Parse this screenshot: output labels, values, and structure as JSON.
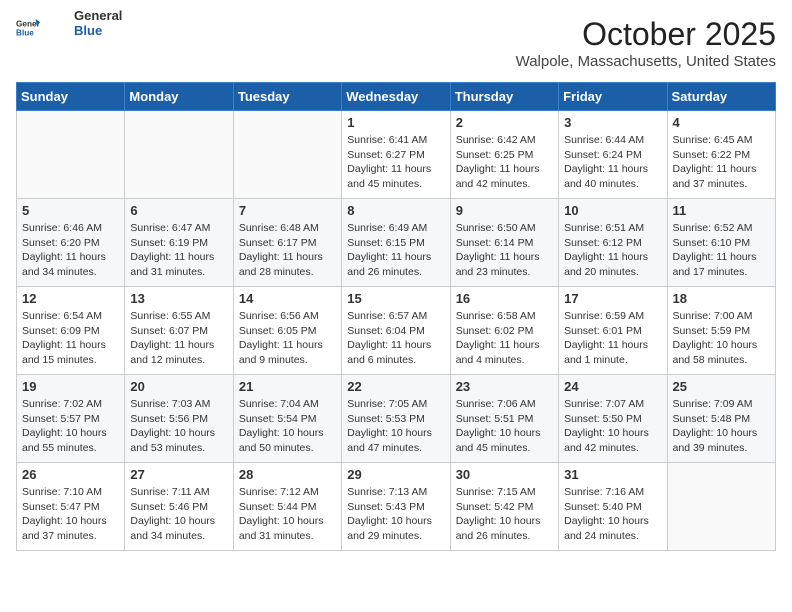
{
  "header": {
    "logo_general": "General",
    "logo_blue": "Blue",
    "month": "October 2025",
    "location": "Walpole, Massachusetts, United States"
  },
  "days_of_week": [
    "Sunday",
    "Monday",
    "Tuesday",
    "Wednesday",
    "Thursday",
    "Friday",
    "Saturday"
  ],
  "weeks": [
    [
      {
        "day": "",
        "info": ""
      },
      {
        "day": "",
        "info": ""
      },
      {
        "day": "",
        "info": ""
      },
      {
        "day": "1",
        "info": "Sunrise: 6:41 AM\nSunset: 6:27 PM\nDaylight: 11 hours and 45 minutes."
      },
      {
        "day": "2",
        "info": "Sunrise: 6:42 AM\nSunset: 6:25 PM\nDaylight: 11 hours and 42 minutes."
      },
      {
        "day": "3",
        "info": "Sunrise: 6:44 AM\nSunset: 6:24 PM\nDaylight: 11 hours and 40 minutes."
      },
      {
        "day": "4",
        "info": "Sunrise: 6:45 AM\nSunset: 6:22 PM\nDaylight: 11 hours and 37 minutes."
      }
    ],
    [
      {
        "day": "5",
        "info": "Sunrise: 6:46 AM\nSunset: 6:20 PM\nDaylight: 11 hours and 34 minutes."
      },
      {
        "day": "6",
        "info": "Sunrise: 6:47 AM\nSunset: 6:19 PM\nDaylight: 11 hours and 31 minutes."
      },
      {
        "day": "7",
        "info": "Sunrise: 6:48 AM\nSunset: 6:17 PM\nDaylight: 11 hours and 28 minutes."
      },
      {
        "day": "8",
        "info": "Sunrise: 6:49 AM\nSunset: 6:15 PM\nDaylight: 11 hours and 26 minutes."
      },
      {
        "day": "9",
        "info": "Sunrise: 6:50 AM\nSunset: 6:14 PM\nDaylight: 11 hours and 23 minutes."
      },
      {
        "day": "10",
        "info": "Sunrise: 6:51 AM\nSunset: 6:12 PM\nDaylight: 11 hours and 20 minutes."
      },
      {
        "day": "11",
        "info": "Sunrise: 6:52 AM\nSunset: 6:10 PM\nDaylight: 11 hours and 17 minutes."
      }
    ],
    [
      {
        "day": "12",
        "info": "Sunrise: 6:54 AM\nSunset: 6:09 PM\nDaylight: 11 hours and 15 minutes."
      },
      {
        "day": "13",
        "info": "Sunrise: 6:55 AM\nSunset: 6:07 PM\nDaylight: 11 hours and 12 minutes."
      },
      {
        "day": "14",
        "info": "Sunrise: 6:56 AM\nSunset: 6:05 PM\nDaylight: 11 hours and 9 minutes."
      },
      {
        "day": "15",
        "info": "Sunrise: 6:57 AM\nSunset: 6:04 PM\nDaylight: 11 hours and 6 minutes."
      },
      {
        "day": "16",
        "info": "Sunrise: 6:58 AM\nSunset: 6:02 PM\nDaylight: 11 hours and 4 minutes."
      },
      {
        "day": "17",
        "info": "Sunrise: 6:59 AM\nSunset: 6:01 PM\nDaylight: 11 hours and 1 minute."
      },
      {
        "day": "18",
        "info": "Sunrise: 7:00 AM\nSunset: 5:59 PM\nDaylight: 10 hours and 58 minutes."
      }
    ],
    [
      {
        "day": "19",
        "info": "Sunrise: 7:02 AM\nSunset: 5:57 PM\nDaylight: 10 hours and 55 minutes."
      },
      {
        "day": "20",
        "info": "Sunrise: 7:03 AM\nSunset: 5:56 PM\nDaylight: 10 hours and 53 minutes."
      },
      {
        "day": "21",
        "info": "Sunrise: 7:04 AM\nSunset: 5:54 PM\nDaylight: 10 hours and 50 minutes."
      },
      {
        "day": "22",
        "info": "Sunrise: 7:05 AM\nSunset: 5:53 PM\nDaylight: 10 hours and 47 minutes."
      },
      {
        "day": "23",
        "info": "Sunrise: 7:06 AM\nSunset: 5:51 PM\nDaylight: 10 hours and 45 minutes."
      },
      {
        "day": "24",
        "info": "Sunrise: 7:07 AM\nSunset: 5:50 PM\nDaylight: 10 hours and 42 minutes."
      },
      {
        "day": "25",
        "info": "Sunrise: 7:09 AM\nSunset: 5:48 PM\nDaylight: 10 hours and 39 minutes."
      }
    ],
    [
      {
        "day": "26",
        "info": "Sunrise: 7:10 AM\nSunset: 5:47 PM\nDaylight: 10 hours and 37 minutes."
      },
      {
        "day": "27",
        "info": "Sunrise: 7:11 AM\nSunset: 5:46 PM\nDaylight: 10 hours and 34 minutes."
      },
      {
        "day": "28",
        "info": "Sunrise: 7:12 AM\nSunset: 5:44 PM\nDaylight: 10 hours and 31 minutes."
      },
      {
        "day": "29",
        "info": "Sunrise: 7:13 AM\nSunset: 5:43 PM\nDaylight: 10 hours and 29 minutes."
      },
      {
        "day": "30",
        "info": "Sunrise: 7:15 AM\nSunset: 5:42 PM\nDaylight: 10 hours and 26 minutes."
      },
      {
        "day": "31",
        "info": "Sunrise: 7:16 AM\nSunset: 5:40 PM\nDaylight: 10 hours and 24 minutes."
      },
      {
        "day": "",
        "info": ""
      }
    ]
  ]
}
